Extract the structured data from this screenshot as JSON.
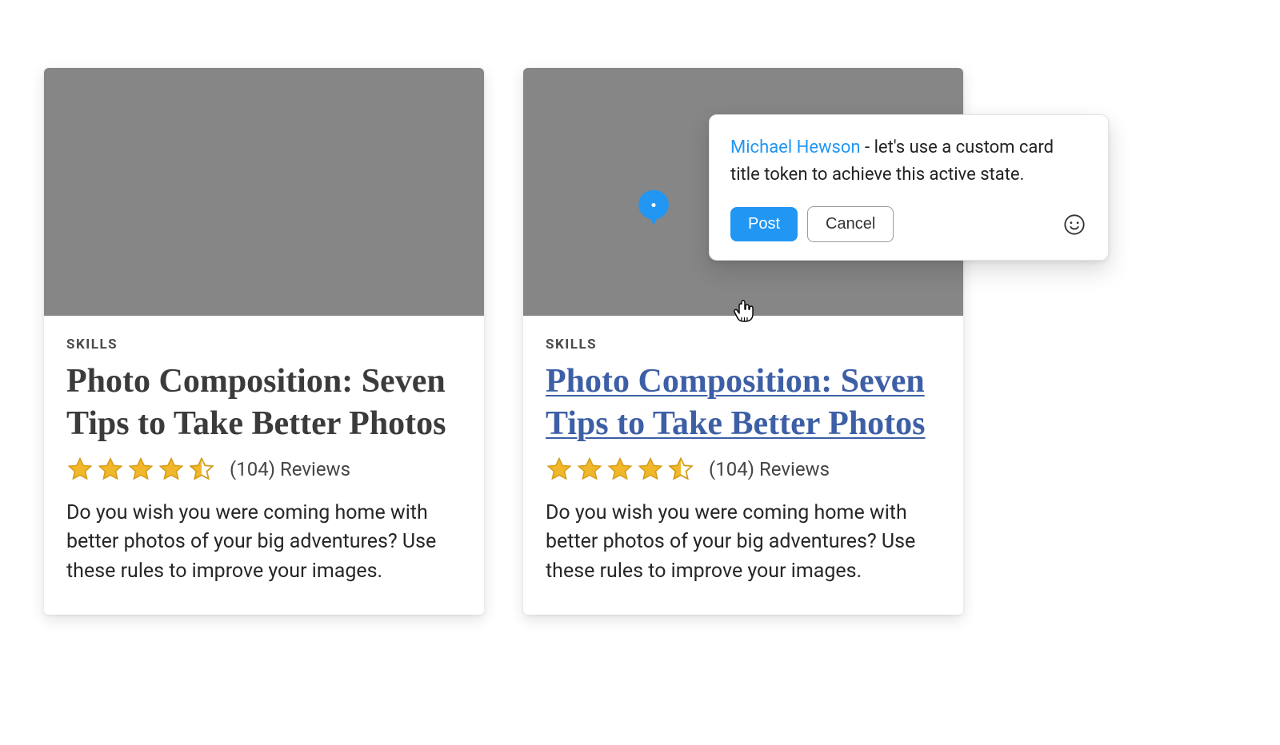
{
  "cards": [
    {
      "eyebrow": "SKILLS",
      "title": "Photo Composition: Seven Tips to Take Better Photos",
      "reviews_label": "(104) Reviews",
      "desc": "Do you wish you were coming home with better photos of your big adventures? Use these rules to improve your images.",
      "rating": 4.5
    },
    {
      "eyebrow": "SKILLS",
      "title": "Photo Composition: Seven Tips to Take Better Photos",
      "reviews_label": "(104) Reviews",
      "desc": "Do you wish you were coming home with better photos of your big adventures? Use these rules to improve your images.",
      "rating": 4.5
    }
  ],
  "comment": {
    "mention": "Michael Hewson",
    "text": " - let's use a custom card title token to achieve this active state.",
    "post_label": "Post",
    "cancel_label": "Cancel"
  },
  "colors": {
    "star": "#f0b72b",
    "title_active": "#3d5fa6",
    "primary": "#2196f3",
    "pin": "#2196f3"
  }
}
